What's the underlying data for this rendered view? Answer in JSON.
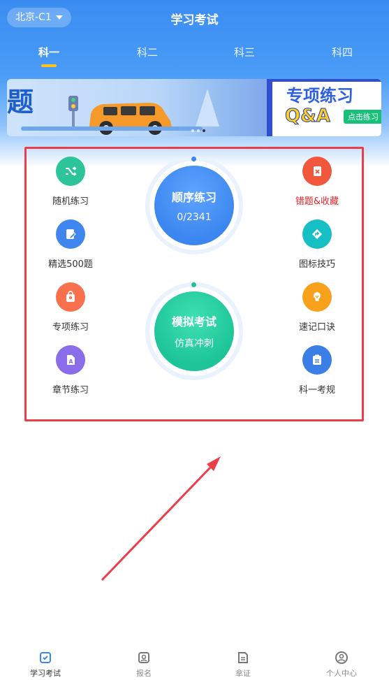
{
  "header": {
    "city": "北京-C1",
    "title": "学习考试"
  },
  "tabs": [
    "科一",
    "科二",
    "科三",
    "科四"
  ],
  "banner": {
    "left_text": "题",
    "panel_title": "专项练习",
    "qa": "Q&A",
    "cta": "点击练习"
  },
  "left_functions": [
    {
      "label": "随机练习",
      "color": "#2ec49a",
      "icon": "shuffle-icon"
    },
    {
      "label": "精选500题",
      "color": "#3f86ee",
      "icon": "edit-note-icon"
    },
    {
      "label": "专项练习",
      "color": "#f7714e",
      "icon": "bag-icon"
    },
    {
      "label": "章节练习",
      "color": "#8a6de8",
      "icon": "document-a-icon"
    }
  ],
  "right_functions": [
    {
      "label": "错题&收藏",
      "color": "#f0573d",
      "icon": "wrong-book-icon"
    },
    {
      "label": "图标技巧",
      "color": "#16bfc4",
      "icon": "road-sign-icon"
    },
    {
      "label": "速记口诀",
      "color": "#f8a21b",
      "icon": "lightbulb-icon"
    },
    {
      "label": "科一考规",
      "color": "#3a7ee6",
      "icon": "clipboard-icon"
    }
  ],
  "order_practice": {
    "title": "顺序练习",
    "progress": "0/2341"
  },
  "mock_exam": {
    "title": "模拟考试",
    "subtitle": "仿真冲刺"
  },
  "bottom_nav": [
    "学习考试",
    "报名",
    "拿证",
    "个人中心"
  ]
}
